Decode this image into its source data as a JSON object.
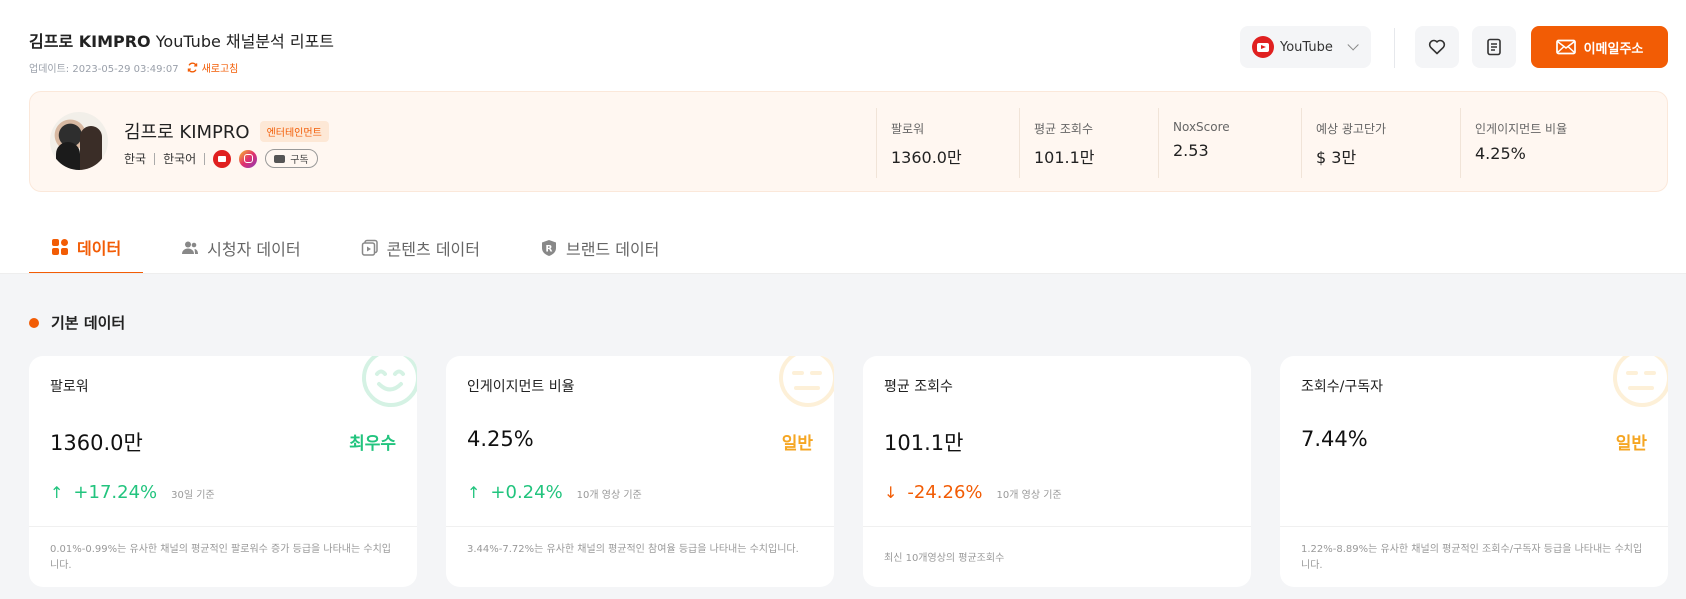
{
  "header": {
    "channel_name": "김프로 KIMPRO",
    "title_suffix": "YouTube 채널분석 리포트",
    "updated": "업데이트: 2023-05-29 03:49:07",
    "refresh_label": "새로고침",
    "platform": "YouTube",
    "email_button": "이메일주소"
  },
  "profile": {
    "name": "김프로 KIMPRO",
    "category": "엔터테인먼트",
    "country": "한국",
    "language": "한국어",
    "subscribe_label": "구독",
    "stats": [
      {
        "label": "팔로워",
        "value": "1360.0만"
      },
      {
        "label": "평균 조회수",
        "value": "101.1만"
      },
      {
        "label": "NoxScore",
        "value": "2.53"
      },
      {
        "label": "예상 광고단가",
        "value": "$ 3만"
      },
      {
        "label": "인게이지먼트 비율",
        "value": "4.25%"
      }
    ]
  },
  "tabs": [
    {
      "label": "데이터",
      "icon": "grid-icon",
      "active": true
    },
    {
      "label": "시청자 데이터",
      "icon": "users-icon",
      "active": false
    },
    {
      "label": "콘텐츠 데이터",
      "icon": "video-icon",
      "active": false
    },
    {
      "label": "브랜드 데이터",
      "icon": "brand-shield-icon",
      "active": false
    }
  ],
  "section_title": "기본 데이터",
  "cards": [
    {
      "label": "팔로워",
      "value": "1360.0만",
      "grade": "최우수",
      "grade_color": "#22c47e",
      "face": "smile-face-icon",
      "direction": "up",
      "change": "+17.24%",
      "basis": "30일 기준",
      "note": "0.01%-0.99%는 유사한 채널의 평균적인 팔로워수 증가 등급을 나타내는 수치입니다."
    },
    {
      "label": "인게이지먼트 비율",
      "value": "4.25%",
      "grade": "일반",
      "grade_color": "#f5a623",
      "face": "neutral-face-icon",
      "direction": "up",
      "change": "+0.24%",
      "basis": "10개 영상 기준",
      "note": "3.44%-7.72%는 유사한 채널의 평균적인 참여율 등급을 나타내는 수치입니다."
    },
    {
      "label": "평균 조회수",
      "value": "101.1만",
      "grade": "",
      "grade_color": "#f5a623",
      "face": "",
      "direction": "down",
      "change": "-24.26%",
      "basis": "10개 영상 기준",
      "note": "최신 10개영상의 평균조회수"
    },
    {
      "label": "조회수/구독자",
      "value": "7.44%",
      "grade": "일반",
      "grade_color": "#f5a623",
      "face": "neutral-face-icon",
      "direction": "",
      "change": "",
      "basis": "",
      "note": "1.22%-8.89%는 유사한 채널의 평균적인 조회수/구독자 등급을 나타내는 수치입니다."
    }
  ],
  "colors": {
    "accent": "#f25c05",
    "positive": "#22c47e",
    "neutral_grade": "#f5a623",
    "body_bg": "#f4f5f7",
    "profile_bg": "#fff7f1"
  }
}
